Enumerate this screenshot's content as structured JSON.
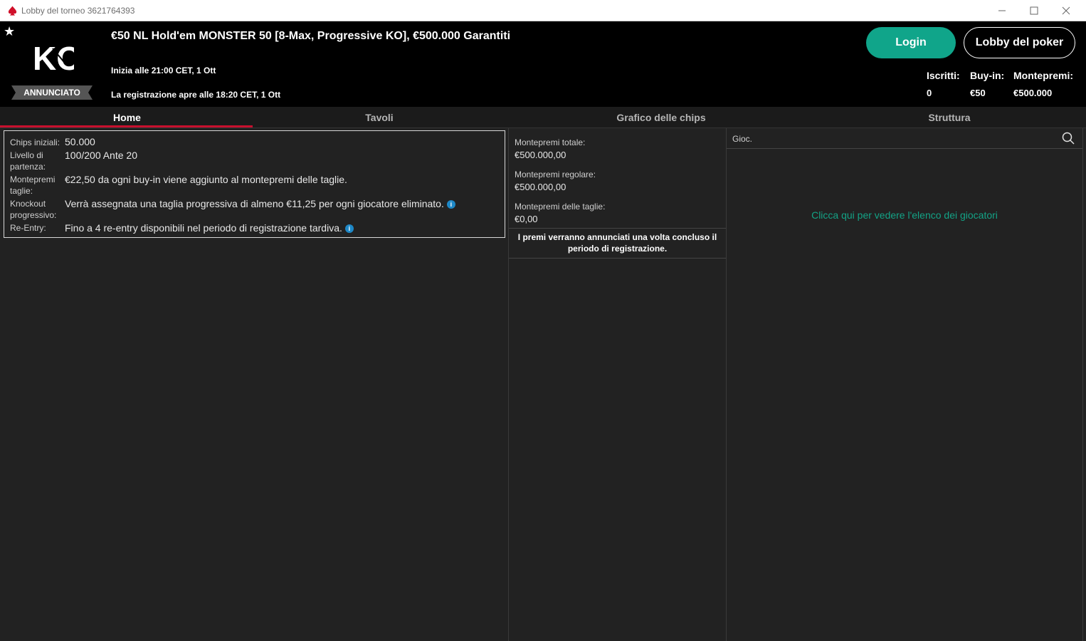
{
  "window": {
    "title": "Lobby del torneo 3621764393"
  },
  "header": {
    "logo_text": "KO",
    "status": "ANNUNCIATO",
    "tournament_title": "€50 NL Hold'em MONSTER 50 [8-Max, Progressive KO], €500.000 Garantiti",
    "start_info": "Inizia alle 21:00 CET, 1 Ott",
    "registration_info": "La registrazione apre alle 18:20 CET, 1 Ott",
    "login_label": "Login",
    "lobby_label": "Lobby del poker",
    "stats": [
      {
        "label": "Iscritti:",
        "value": "0"
      },
      {
        "label": "Buy-in:",
        "value": "€50"
      },
      {
        "label": "Montepremi:",
        "value": "€500.000"
      }
    ]
  },
  "tabs": [
    {
      "label": "Home",
      "active": true
    },
    {
      "label": "Tavoli",
      "active": false
    },
    {
      "label": "Grafico delle chips",
      "active": false
    },
    {
      "label": "Struttura",
      "active": false
    }
  ],
  "info": {
    "rows": [
      {
        "label": "Chips iniziali:",
        "value": "50.000"
      },
      {
        "label": "Livello di partenza:",
        "value": "100/200 Ante 20"
      },
      {
        "label": "Montepremi taglie:",
        "value": "€22,50 da ogni buy-in viene aggiunto al montepremi delle taglie."
      },
      {
        "label": "Knockout progressivo:",
        "value": "Verrà assegnata una taglia progressiva di almeno €11,25 per ogni giocatore eliminato."
      },
      {
        "label": "Re-Entry:",
        "value": "Fino a 4 re-entry disponibili nel periodo di registrazione tardiva."
      }
    ],
    "info_icon_glyph": "i"
  },
  "prizes": {
    "total_label": "Montepremi totale:",
    "total_value": "€500.000,00",
    "regular_label": "Montepremi regolare:",
    "regular_value": "€500.000,00",
    "bounty_label": "Montepremi delle taglie:",
    "bounty_value": "€0,00",
    "note": "I premi verranno annunciati una volta concluso il periodo di registrazione."
  },
  "players": {
    "search_placeholder": "Gioc.",
    "link_label": "Clicca qui per vedere l'elenco dei giocatori"
  },
  "colors": {
    "accent": "#10a58a",
    "tab_active_underline": "#c8102e",
    "info_icon": "#1e88c7"
  }
}
